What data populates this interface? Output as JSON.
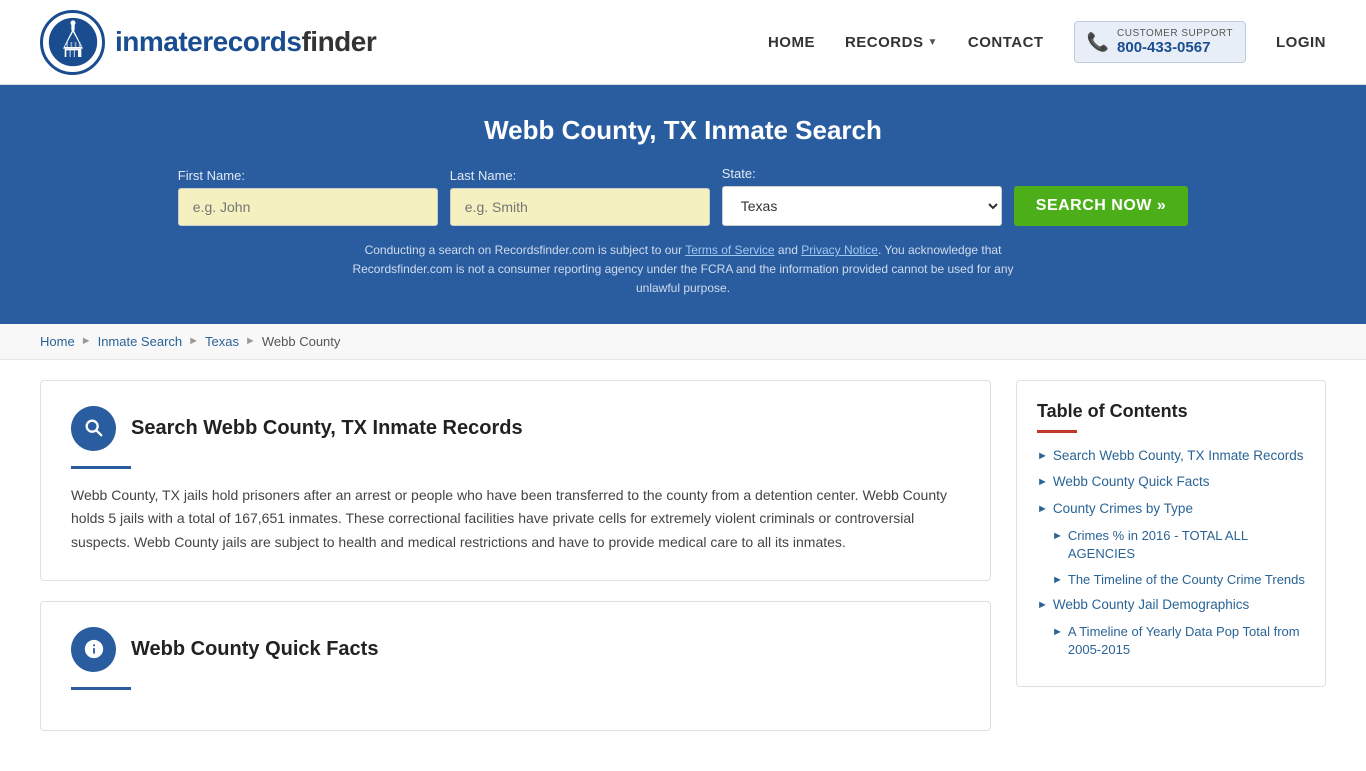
{
  "header": {
    "logo_text_main": "inmaterecords",
    "logo_text_bold": "finder",
    "nav": {
      "home": "HOME",
      "records": "RECORDS",
      "contact": "CONTACT",
      "customer_support_label": "CUSTOMER SUPPORT",
      "customer_support_number": "800-433-0567",
      "login": "LOGIN"
    }
  },
  "hero": {
    "title": "Webb County, TX Inmate Search",
    "first_name_label": "First Name:",
    "first_name_placeholder": "e.g. John",
    "last_name_label": "Last Name:",
    "last_name_placeholder": "e.g. Smith",
    "state_label": "State:",
    "state_value": "Texas",
    "search_button": "SEARCH NOW »",
    "disclaimer": "Conducting a search on Recordsfinder.com is subject to our Terms of Service and Privacy Notice. You acknowledge that Recordsfinder.com is not a consumer reporting agency under the FCRA and the information provided cannot be used for any unlawful purpose."
  },
  "breadcrumb": {
    "home": "Home",
    "inmate_search": "Inmate Search",
    "texas": "Texas",
    "current": "Webb County"
  },
  "main": {
    "section1": {
      "title": "Search Webb County, TX Inmate Records",
      "body": "Webb County, TX jails hold prisoners after an arrest or people who have been transferred to the county from a detention center. Webb County holds 5 jails with a total of 167,651 inmates. These correctional facilities have private cells for extremely violent criminals or controversial suspects. Webb County jails are subject to health and medical restrictions and have to provide medical care to all its inmates."
    },
    "section2": {
      "title": "Webb County Quick Facts"
    }
  },
  "toc": {
    "title": "Table of Contents",
    "items": [
      {
        "label": "Search Webb County, TX Inmate Records",
        "sub": false
      },
      {
        "label": "Webb County Quick Facts",
        "sub": false
      },
      {
        "label": "County Crimes by Type",
        "sub": false
      },
      {
        "label": "Crimes % in 2016 - TOTAL ALL AGENCIES",
        "sub": true
      },
      {
        "label": "The Timeline of the County Crime Trends",
        "sub": true
      },
      {
        "label": "Webb County Jail Demographics",
        "sub": false
      },
      {
        "label": "A Timeline of Yearly Data Pop Total from 2005-2015",
        "sub": true
      }
    ]
  }
}
